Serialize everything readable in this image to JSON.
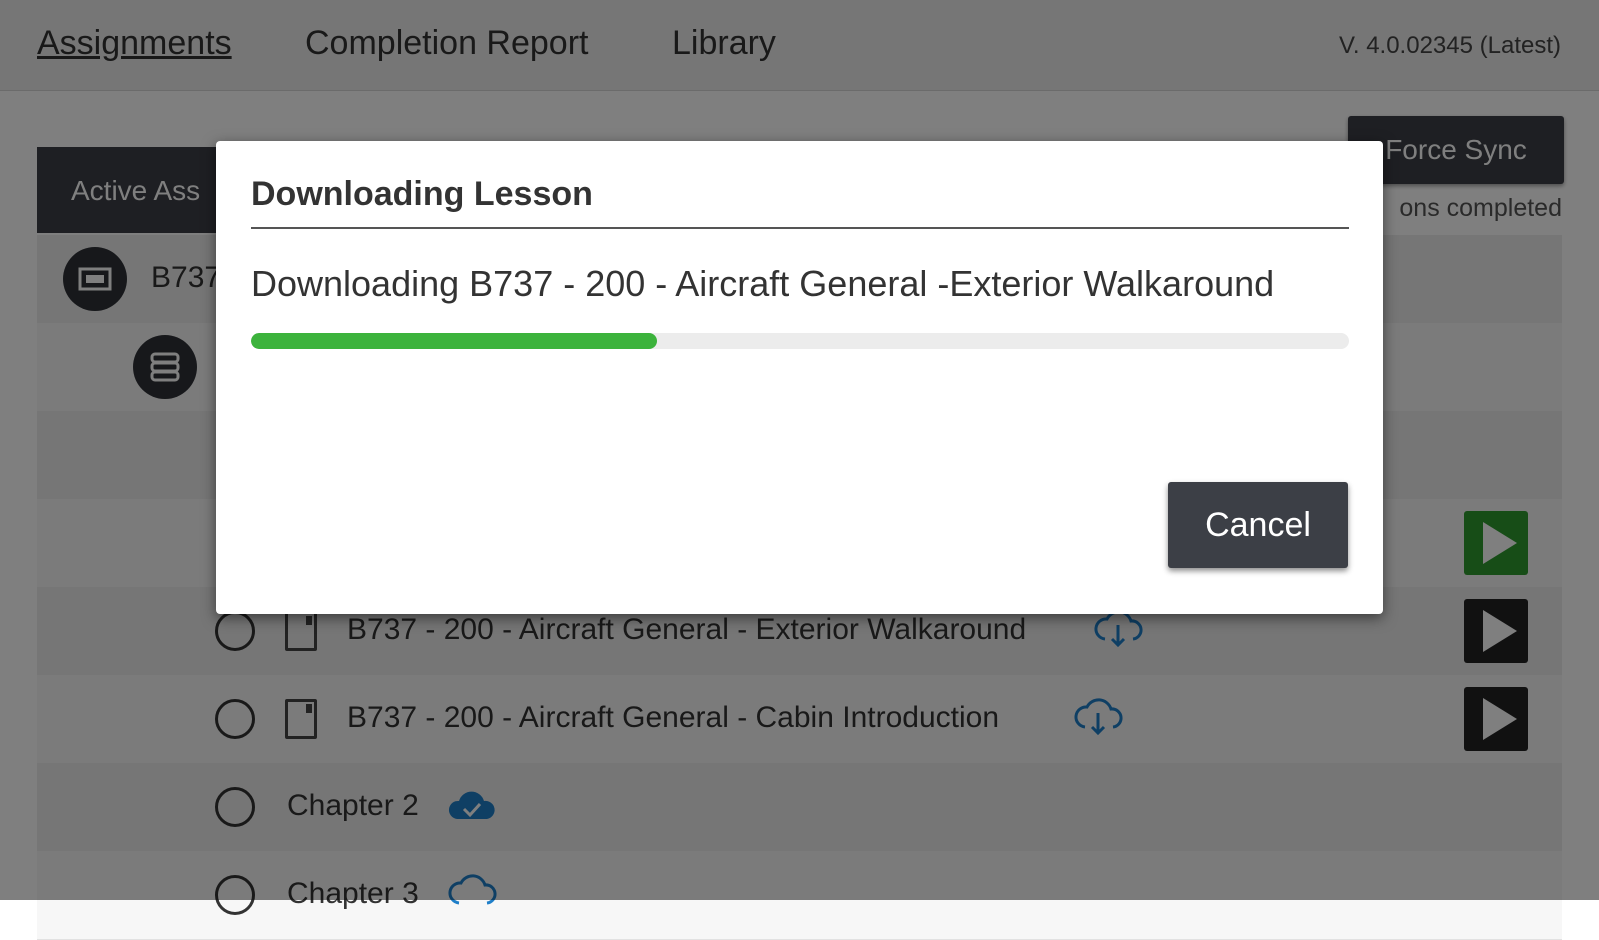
{
  "nav": {
    "tabs": [
      {
        "label": "Assignments",
        "active": true
      },
      {
        "label": "Completion Report",
        "active": false
      },
      {
        "label": "Library",
        "active": false
      }
    ],
    "version": "V. 4.0.02345 (Latest)"
  },
  "background": {
    "force_sync_label": "Force Sync",
    "lessons_completed": "ons completed",
    "active_tab": "Active Ass",
    "row0_label": "B737",
    "rows": [
      {
        "label": "B737 - 200 - Aircraft General - Exterior Walkaround",
        "cloud_icon": "cloud-download-icon"
      },
      {
        "label": "B737 - 200 - Aircraft General - Cabin Introduction",
        "cloud_icon": "cloud-download-icon"
      },
      {
        "label": "Chapter 2",
        "cloud_icon": "cloud-check-icon"
      },
      {
        "label": "Chapter 3",
        "cloud_icon": "cloud-download-icon"
      }
    ]
  },
  "modal": {
    "title": "Downloading Lesson",
    "message": "Downloading B737 - 200 - Aircraft General -Exterior Walkaround",
    "progress_fraction": 0.37,
    "cancel_label": "Cancel"
  },
  "colors": {
    "progress": "#3cb33c",
    "play_active": "#2f9a2f",
    "cloud_blue": "#1f7fc9"
  }
}
